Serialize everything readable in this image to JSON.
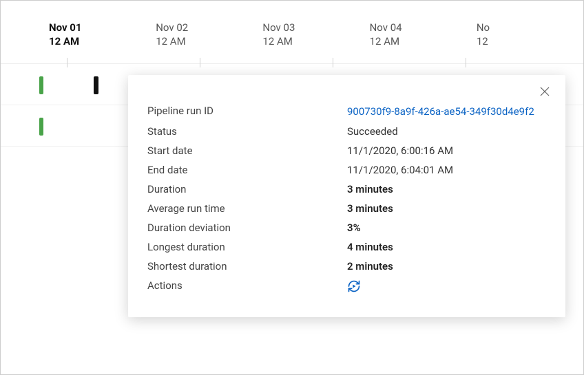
{
  "timeline": {
    "dates": [
      {
        "date": "Nov 01",
        "time": "12 AM",
        "active": true
      },
      {
        "date": "Nov 02",
        "time": "12 AM",
        "active": false
      },
      {
        "date": "Nov 03",
        "time": "12 AM",
        "active": false
      },
      {
        "date": "Nov 04",
        "time": "12 AM",
        "active": false
      },
      {
        "date": "No",
        "time": "12",
        "active": false
      }
    ]
  },
  "tooltip": {
    "rows": {
      "run_id": {
        "label": "Pipeline run ID",
        "value": "900730f9-8a9f-426a-ae54-349f30d4e9f2"
      },
      "status": {
        "label": "Status",
        "value": "Succeeded"
      },
      "start": {
        "label": "Start date",
        "value": "11/1/2020, 6:00:16 AM"
      },
      "end": {
        "label": "End date",
        "value": "11/1/2020, 6:04:01 AM"
      },
      "duration": {
        "label": "Duration",
        "value": "3 minutes"
      },
      "avg": {
        "label": "Average run time",
        "value": "3 minutes"
      },
      "deviation": {
        "label": "Duration deviation",
        "value": "3%"
      },
      "longest": {
        "label": "Longest duration",
        "value": "4 minutes"
      },
      "shortest": {
        "label": "Shortest duration",
        "value": "2 minutes"
      },
      "actions": {
        "label": "Actions"
      }
    }
  }
}
